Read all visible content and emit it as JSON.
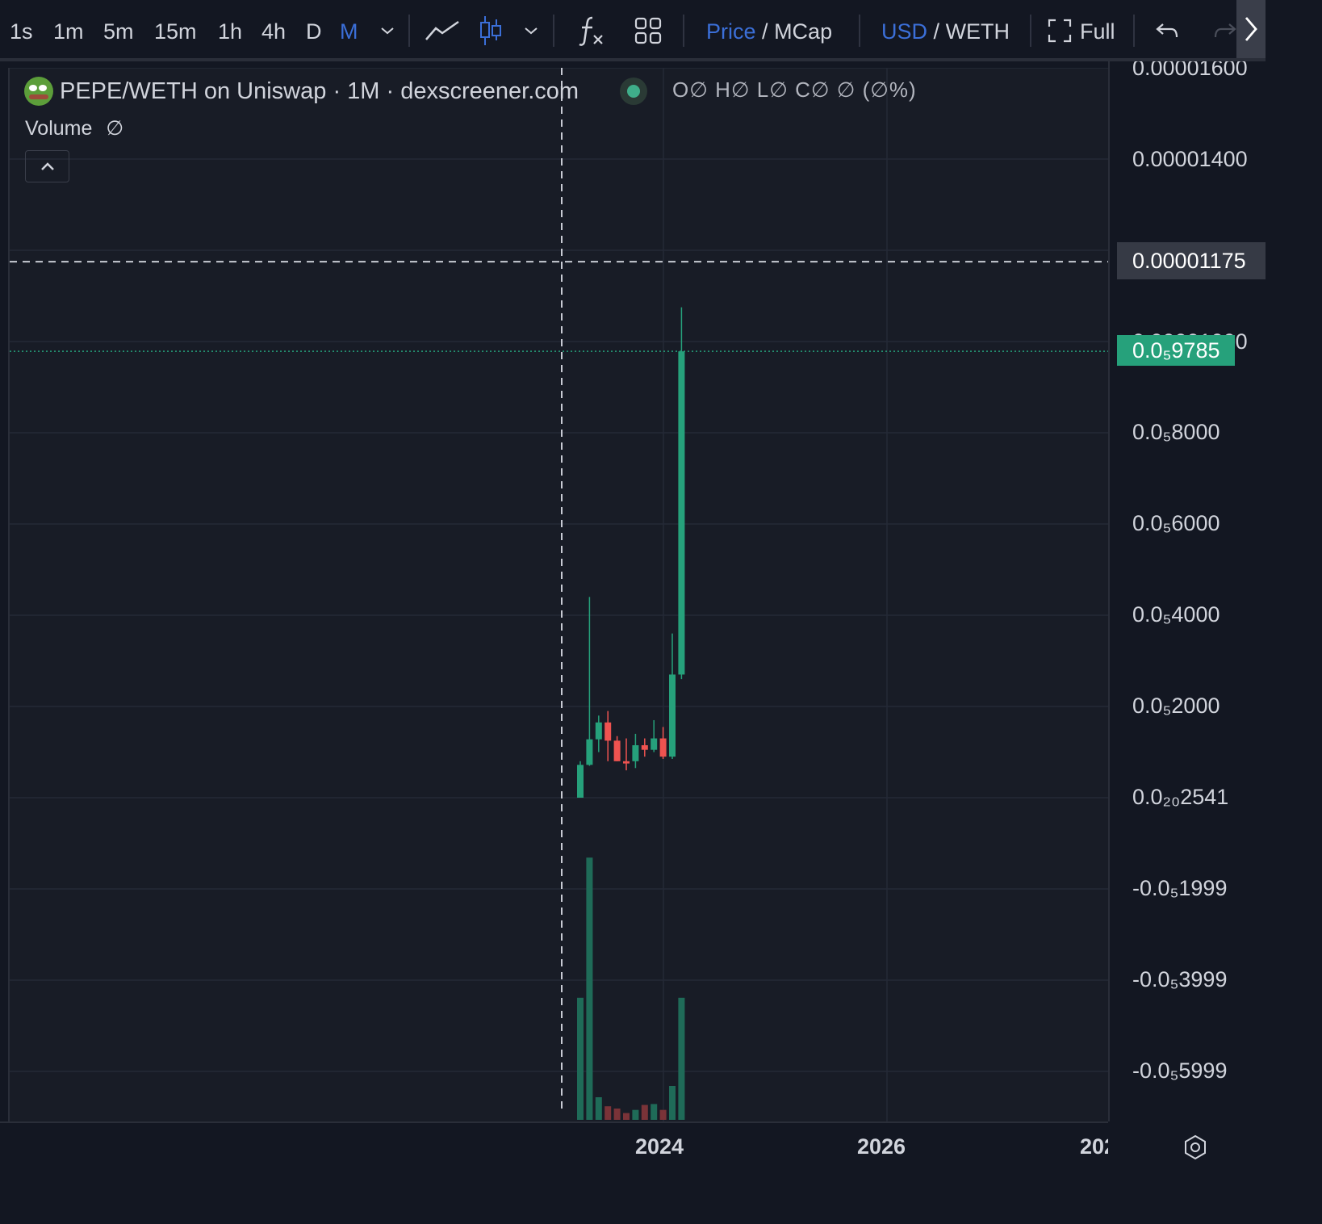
{
  "toolbar": {
    "intervals": [
      "1s",
      "1m",
      "5m",
      "15m",
      "1h",
      "4h",
      "D",
      "M"
    ],
    "active_interval": "M",
    "price_label": "Price",
    "mcap_label": "MCap",
    "usd_label": "USD",
    "weth_label": "WETH",
    "full_label": "Full",
    "separator": "/"
  },
  "legend": {
    "title": "PEPE/WETH on Uniswap · 1M · dexscreener.com",
    "ohlc": "O∅ H∅ L∅ C∅ ∅ (∅%)",
    "volume_label": "Volume",
    "volume_value": "∅"
  },
  "price_scale": {
    "labels": [
      "0.00001600",
      "0.00001400",
      "0.00001000",
      "0.0₅8000",
      "0.0₅6000",
      "0.0₅4000",
      "0.0₅2000",
      "0.0₂₀2541",
      "-0.0₅1999",
      "-0.0₅3999",
      "-0.0₅5999"
    ],
    "crosshair_value": "0.00001175",
    "last_price": "0.0₅9785"
  },
  "time_scale": {
    "labels": [
      "2024",
      "2026",
      "202"
    ]
  },
  "colors": {
    "background": "#131722",
    "pane": "#181c26",
    "up": "#26a17b",
    "down": "#ef5350",
    "accent": "#3b6fd8"
  },
  "chart_data": {
    "type": "candlestick",
    "title": "PEPE/WETH on Uniswap · 1M · dexscreener.com",
    "interval": "1M",
    "ylim": [
      -7e-06,
      1.7e-05
    ],
    "last_price": 9.785e-06,
    "crosshair_price": 1.175e-05,
    "candles": [
      {
        "o": 0.0,
        "h": 8e-07,
        "l": 0.0,
        "c": 7.2e-07,
        "dir": "up"
      },
      {
        "o": 7.2e-07,
        "h": 4.4e-06,
        "l": 7e-07,
        "c": 1.28e-06,
        "dir": "up"
      },
      {
        "o": 1.28e-06,
        "h": 1.8e-06,
        "l": 1e-06,
        "c": 1.65e-06,
        "dir": "up"
      },
      {
        "o": 1.65e-06,
        "h": 1.9e-06,
        "l": 8e-07,
        "c": 1.25e-06,
        "dir": "down"
      },
      {
        "o": 1.25e-06,
        "h": 1.35e-06,
        "l": 8e-07,
        "c": 8e-07,
        "dir": "down"
      },
      {
        "o": 8e-07,
        "h": 1.3e-06,
        "l": 6e-07,
        "c": 7.5e-07,
        "dir": "down"
      },
      {
        "o": 8e-07,
        "h": 1.4e-06,
        "l": 6.5e-07,
        "c": 1.15e-06,
        "dir": "up"
      },
      {
        "o": 1.15e-06,
        "h": 1.3e-06,
        "l": 9e-07,
        "c": 1.05e-06,
        "dir": "down"
      },
      {
        "o": 1.05e-06,
        "h": 1.7e-06,
        "l": 1e-06,
        "c": 1.3e-06,
        "dir": "up"
      },
      {
        "o": 1.3e-06,
        "h": 1.55e-06,
        "l": 8.5e-07,
        "c": 9e-07,
        "dir": "down"
      },
      {
        "o": 9e-07,
        "h": 3.6e-06,
        "l": 8.5e-07,
        "c": 2.7e-06,
        "dir": "up"
      },
      {
        "o": 2.7e-06,
        "h": 1.075e-05,
        "l": 2.6e-06,
        "c": 9.785e-06,
        "dir": "up"
      }
    ],
    "volume": [
      0.27,
      0.58,
      0.05,
      0.03,
      0.025,
      0.015,
      0.022,
      0.033,
      0.035,
      0.022,
      0.075,
      0.27
    ]
  }
}
